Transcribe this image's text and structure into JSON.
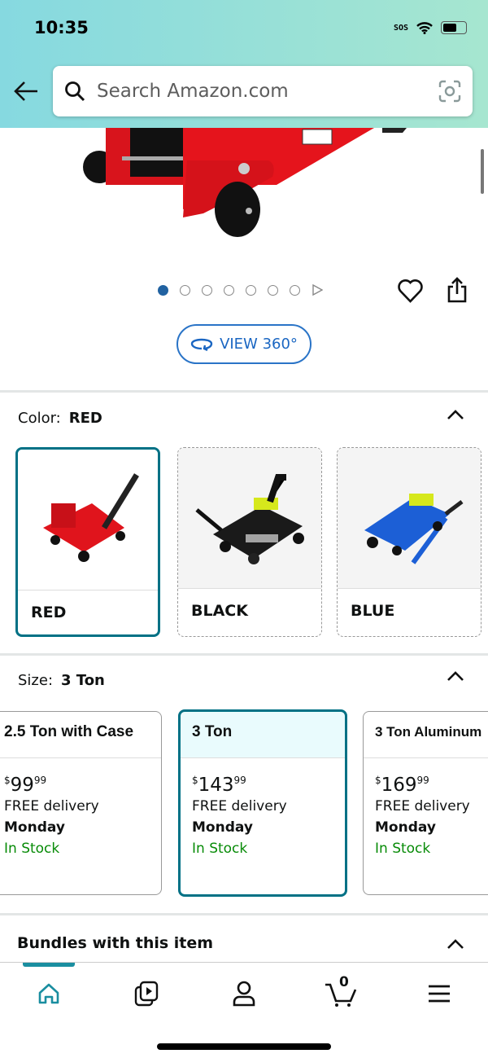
{
  "status_bar": {
    "time": "10:35",
    "sos": "SOS"
  },
  "search": {
    "placeholder": "Search Amazon.com"
  },
  "gallery": {
    "image_count": 7,
    "active_index": 0,
    "view360_label": "VIEW 360°"
  },
  "color": {
    "label": "Color:",
    "selected": "RED",
    "options": [
      {
        "name": "RED",
        "color": "#e0141c",
        "selected": true
      },
      {
        "name": "BLACK",
        "color": "#1a1a1a",
        "selected": false
      },
      {
        "name": "BLUE",
        "color": "#1c5fd6",
        "selected": false
      }
    ]
  },
  "size": {
    "label": "Size:",
    "selected": "3 Ton",
    "options": [
      {
        "name": "2.5 Ton with Case",
        "dollars": "99",
        "cents": "99",
        "currency": "$",
        "delivery": "FREE delivery",
        "day": "Monday",
        "stock": "In Stock"
      },
      {
        "name": "3 Ton",
        "dollars": "143",
        "cents": "99",
        "currency": "$",
        "delivery": "FREE delivery",
        "day": "Monday",
        "stock": "In Stock"
      },
      {
        "name": "3 Ton Aluminum",
        "dollars": "169",
        "cents": "99",
        "currency": "$",
        "delivery": "FREE delivery",
        "day": "Monday",
        "stock": "In Stock"
      }
    ]
  },
  "bundles": {
    "title": "Bundles with this item"
  },
  "nav": {
    "cart_count": "0",
    "active": "home",
    "accent": "#007185"
  }
}
